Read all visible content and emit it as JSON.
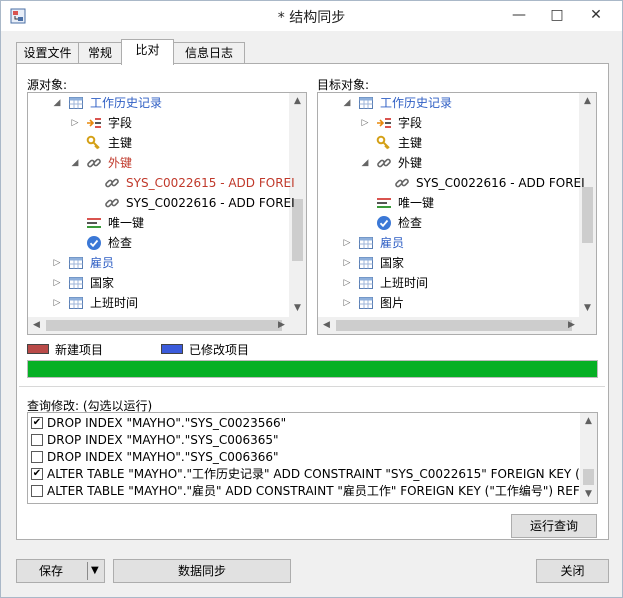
{
  "window": {
    "title": "* 结构同步",
    "icons": [
      "app-icon",
      "minimize-icon",
      "maximize-icon",
      "close-icon"
    ]
  },
  "tabs": [
    "设置文件",
    "常规",
    "比对",
    "信息日志"
  ],
  "source": {
    "label": "源对象:",
    "rows": [
      {
        "text": "工作历史记录",
        "icon": "table-icon",
        "style": "blue",
        "exp": "open"
      },
      {
        "text": "字段",
        "icon": "fields-icon",
        "style": "",
        "exp": "closed"
      },
      {
        "text": "主键",
        "icon": "key-icon",
        "style": "",
        "exp": ""
      },
      {
        "text": "外键",
        "icon": "link-icon",
        "style": "red",
        "exp": "open"
      },
      {
        "text": "SYS_C0022615 - ADD FOREI",
        "icon": "link-icon",
        "style": "red",
        "exp": ""
      },
      {
        "text": "SYS_C0022616 - ADD FOREI",
        "icon": "link-icon",
        "style": "",
        "exp": ""
      },
      {
        "text": "唯一键",
        "icon": "unique-icon",
        "style": "",
        "exp": ""
      },
      {
        "text": "检查",
        "icon": "check-icon",
        "style": "",
        "exp": ""
      },
      {
        "text": "雇员",
        "icon": "table-icon",
        "style": "blue",
        "exp": "closed"
      },
      {
        "text": "国家",
        "icon": "table-icon",
        "style": "",
        "exp": "closed"
      },
      {
        "text": "上班时间",
        "icon": "table-icon",
        "style": "",
        "exp": "closed"
      }
    ]
  },
  "target": {
    "label": "目标对象:",
    "rows": [
      {
        "text": "工作历史记录",
        "icon": "table-icon",
        "style": "blue",
        "exp": "open"
      },
      {
        "text": "字段",
        "icon": "fields-icon",
        "style": "",
        "exp": "closed"
      },
      {
        "text": "主键",
        "icon": "key-icon",
        "style": "",
        "exp": ""
      },
      {
        "text": "外键",
        "icon": "link-icon",
        "style": "",
        "exp": "open"
      },
      {
        "text": "SYS_C0022616 - ADD FOREI",
        "icon": "link-icon",
        "style": "",
        "exp": ""
      },
      {
        "text": "唯一键",
        "icon": "unique-icon",
        "style": "",
        "exp": ""
      },
      {
        "text": "检查",
        "icon": "check-icon",
        "style": "",
        "exp": ""
      },
      {
        "text": "雇员",
        "icon": "table-icon",
        "style": "blue",
        "exp": "closed"
      },
      {
        "text": "国家",
        "icon": "table-icon",
        "style": "",
        "exp": "closed"
      },
      {
        "text": "上班时间",
        "icon": "table-icon",
        "style": "",
        "exp": "closed"
      },
      {
        "text": "图片",
        "icon": "table-icon",
        "style": "",
        "exp": "closed"
      }
    ]
  },
  "legend": {
    "new_label": "新建项目",
    "new_color": "#b94a48",
    "modified_label": "已修改项目",
    "modified_color": "#3b5bdb"
  },
  "progress": {
    "value": 1.0,
    "color": "#06b025"
  },
  "queries": {
    "label": "查询修改: (勾选以运行)",
    "items": [
      {
        "checked": true,
        "text": "DROP INDEX \"MAYHO\".\"SYS_C0023566\""
      },
      {
        "checked": false,
        "text": "DROP INDEX \"MAYHO\".\"SYS_C006365\""
      },
      {
        "checked": false,
        "text": "DROP INDEX \"MAYHO\".\"SYS_C006366\""
      },
      {
        "checked": true,
        "text": "ALTER TABLE \"MAYHO\".\"工作历史记录\" ADD CONSTRAINT \"SYS_C0022615\" FOREIGN KEY (\"工"
      },
      {
        "checked": false,
        "text": "ALTER TABLE \"MAYHO\".\"雇员\" ADD CONSTRAINT \"雇员工作\" FOREIGN KEY (\"工作编号\") REFE"
      }
    ]
  },
  "buttons": {
    "run_query": "运行查询",
    "save": "保存",
    "data_sync": "数据同步",
    "close": "关闭"
  }
}
